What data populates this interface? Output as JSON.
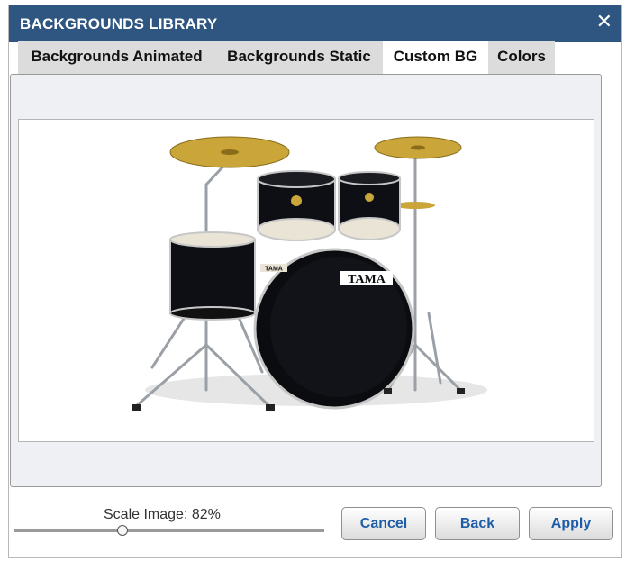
{
  "dialog": {
    "title": "BACKGROUNDS LIBRARY",
    "close_glyph": "✕"
  },
  "tabs": [
    {
      "label": "Backgrounds Animated",
      "active": false
    },
    {
      "label": "Backgrounds Static",
      "active": false
    },
    {
      "label": "Custom BG",
      "active": true
    },
    {
      "label": "Colors",
      "active": false
    }
  ],
  "preview": {
    "brand_text": "TAMA",
    "small_badge": "TAMA"
  },
  "scale": {
    "label": "Scale Image: 82%",
    "value_percent": 82
  },
  "buttons": {
    "cancel": "Cancel",
    "back": "Back",
    "apply": "Apply"
  },
  "colors": {
    "titlebar": "#2f5680",
    "button_text": "#1d5da8",
    "tab_inactive": "#dcdcdc",
    "panel_bg": "#eef0f4"
  }
}
